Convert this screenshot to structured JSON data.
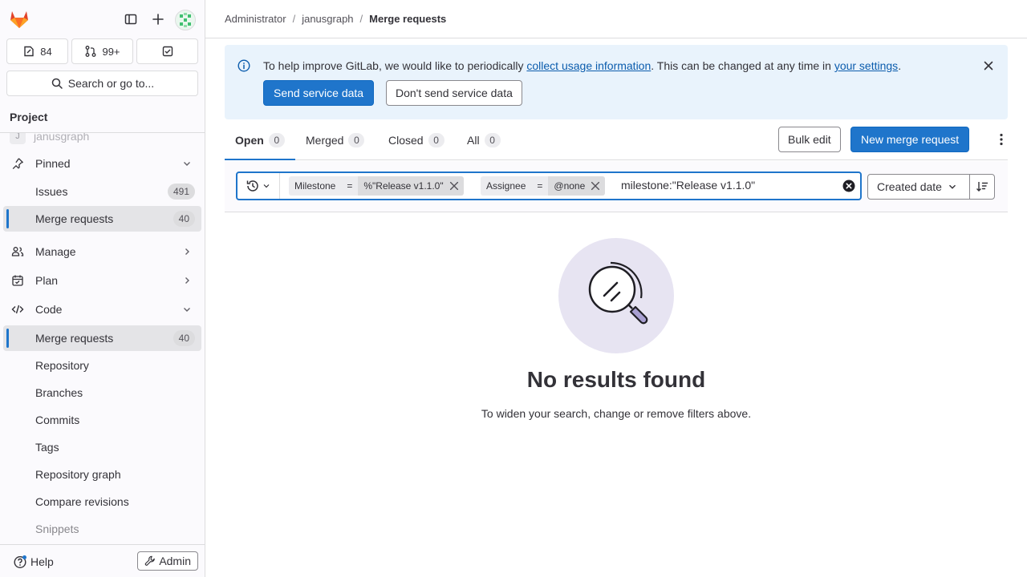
{
  "sidebar": {
    "issues_count": "84",
    "mr_count": "99+",
    "search_label": "Search or go to...",
    "section_title": "Project",
    "ghost_label": "janusgraph",
    "ghost_avatar": "J",
    "pinned_label": "Pinned",
    "items": [
      {
        "label": "Issues",
        "badge": "491"
      },
      {
        "label": "Merge requests",
        "badge": "40"
      },
      {
        "label": "Manage"
      },
      {
        "label": "Plan"
      },
      {
        "label": "Code"
      },
      {
        "label": "Merge requests",
        "badge": "40"
      },
      {
        "label": "Repository"
      },
      {
        "label": "Branches"
      },
      {
        "label": "Commits"
      },
      {
        "label": "Tags"
      },
      {
        "label": "Repository graph"
      },
      {
        "label": "Compare revisions"
      },
      {
        "label": "Snippets"
      }
    ],
    "help_label": "Help",
    "admin_label": "Admin"
  },
  "breadcrumb": {
    "items": [
      "Administrator",
      "janusgraph",
      "Merge requests"
    ],
    "separator": "/"
  },
  "alert": {
    "text_1": "To help improve GitLab, we would like to periodically ",
    "link_1": "collect usage information",
    "text_2": ". This can be changed at any time in ",
    "link_2": "your settings",
    "text_3": ".",
    "send_label": "Send service data",
    "dont_send_label": "Don't send service data"
  },
  "tabs": [
    {
      "label": "Open",
      "count": "0"
    },
    {
      "label": "Merged",
      "count": "0"
    },
    {
      "label": "Closed",
      "count": "0"
    },
    {
      "label": "All",
      "count": "0"
    }
  ],
  "actions": {
    "bulk_edit": "Bulk edit",
    "new_mr": "New merge request"
  },
  "filter": {
    "tokens": [
      {
        "key": "Milestone",
        "op": "=",
        "value": "%\"Release v1.1.0\""
      },
      {
        "key": "Assignee",
        "op": "=",
        "value": "@none"
      }
    ],
    "text": "milestone:\"Release v1.1.0\"",
    "sort_label": "Created date"
  },
  "empty": {
    "title": "No results found",
    "description": "To widen your search, change or remove filters above."
  },
  "colors": {
    "primary": "#1f75cb",
    "alert_bg": "#e9f3fc",
    "illustration_bg": "#e7e4f2",
    "logo_orange": "#e24329"
  }
}
